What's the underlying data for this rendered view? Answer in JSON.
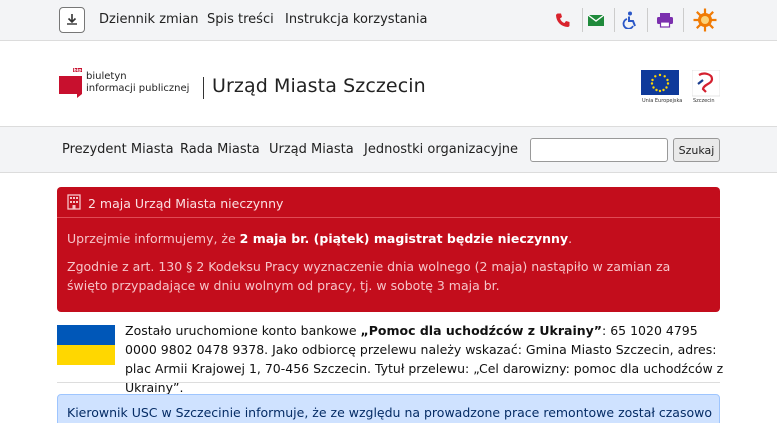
{
  "topbar": {
    "download_icon": "download-icon",
    "links": [
      "Dziennik zmian",
      "Spis treści",
      "Instrukcja korzystania"
    ],
    "icons": [
      "phone-icon",
      "email-icon",
      "accessibility-icon",
      "print-icon",
      "contrast-icon"
    ]
  },
  "header": {
    "bip_line1": "biuletyn",
    "bip_line2": "informacji publicznej",
    "bip_badge": "bip",
    "title": "Urząd Miasta Szczecin",
    "eu_caption": "Unia Europejska",
    "szczecin_caption": "Szczecin"
  },
  "nav": {
    "items": [
      "Prezydent Miasta",
      "Rada Miasta",
      "Urząd Miasta",
      "Jednostki organizacyjne"
    ],
    "search_placeholder": "",
    "search_button": "Szukaj"
  },
  "alert": {
    "heading": "2 maja Urząd Miasta nieczynny",
    "p1_before": "Uprzejmie informujemy, że ",
    "p1_bold": "2 maja br. (piątek) magistrat będzie nieczynny",
    "p1_after": ".",
    "p2": "Zgodnie z art. 130 § 2 Kodeksu Pracy wyznaczenie dnia wolnego (2 maja) nastąpiło w zamian za święto przypadające w dniu wolnym od pracy, tj. w sobotę 3 maja br.",
    "color": "#c30d1c"
  },
  "ukraine": {
    "t1": "Zostało uruchomione konto bankowe ",
    "t2": "„Pomoc dla uchodźców z Ukrainy”",
    "t3": ": 65 1020 4795 0000 9802 0478 9378. Jako odbiorcę przelewu należy wskazać: Gmina Miasto Szczecin, adres: plac Armii Krajowej 1, 70-456 Szczecin. Tytuł przelewu: „Cel darowizny: pomoc dla uchodźców z Ukrainy”."
  },
  "info": {
    "text": "Kierownik USC w Szczecinie informuje, że ze względu na prowadzone prace remontowe został czasowo"
  }
}
